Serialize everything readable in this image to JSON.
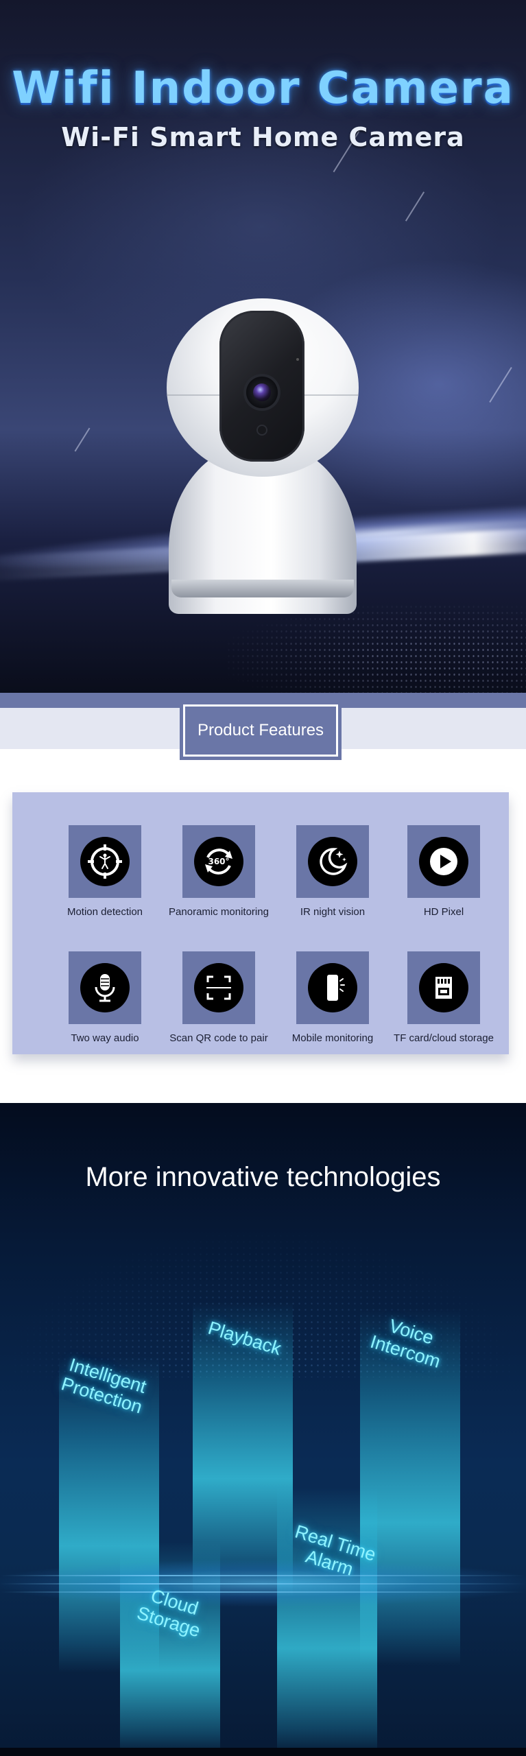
{
  "hero": {
    "title": "Wifi Indoor Camera",
    "subtitle": "Wi-Fi Smart Home Camera"
  },
  "features_section": {
    "heading": "Product Features",
    "items": [
      {
        "label": "Motion detection",
        "icon": "motion-detection-icon"
      },
      {
        "label": "Panoramic monitoring",
        "icon": "panorama-360-icon",
        "icon_text": "360°"
      },
      {
        "label": "IR night vision",
        "icon": "moon-stars-icon"
      },
      {
        "label": "HD Pixel",
        "icon": "play-icon"
      },
      {
        "label": "Two way audio",
        "icon": "microphone-icon"
      },
      {
        "label": "Scan QR code to pair",
        "icon": "qr-scan-icon"
      },
      {
        "label": "Mobile monitoring",
        "icon": "smartphone-icon"
      },
      {
        "label": "TF card/cloud storage",
        "icon": "sd-card-icon"
      }
    ]
  },
  "technologies": {
    "heading": "More innovative technologies",
    "labels": {
      "intelligent_protection": "Intelligent\nProtection",
      "playback": "Playback",
      "voice_intercom": "Voice\nIntercom",
      "real_time_alarm": "Real Time\nAlarm",
      "cloud_storage": "Cloud\nStorage"
    }
  },
  "colors": {
    "accent": "#6a76a7",
    "panel": "#b8bfe4",
    "glow": "#8ff3ff"
  }
}
